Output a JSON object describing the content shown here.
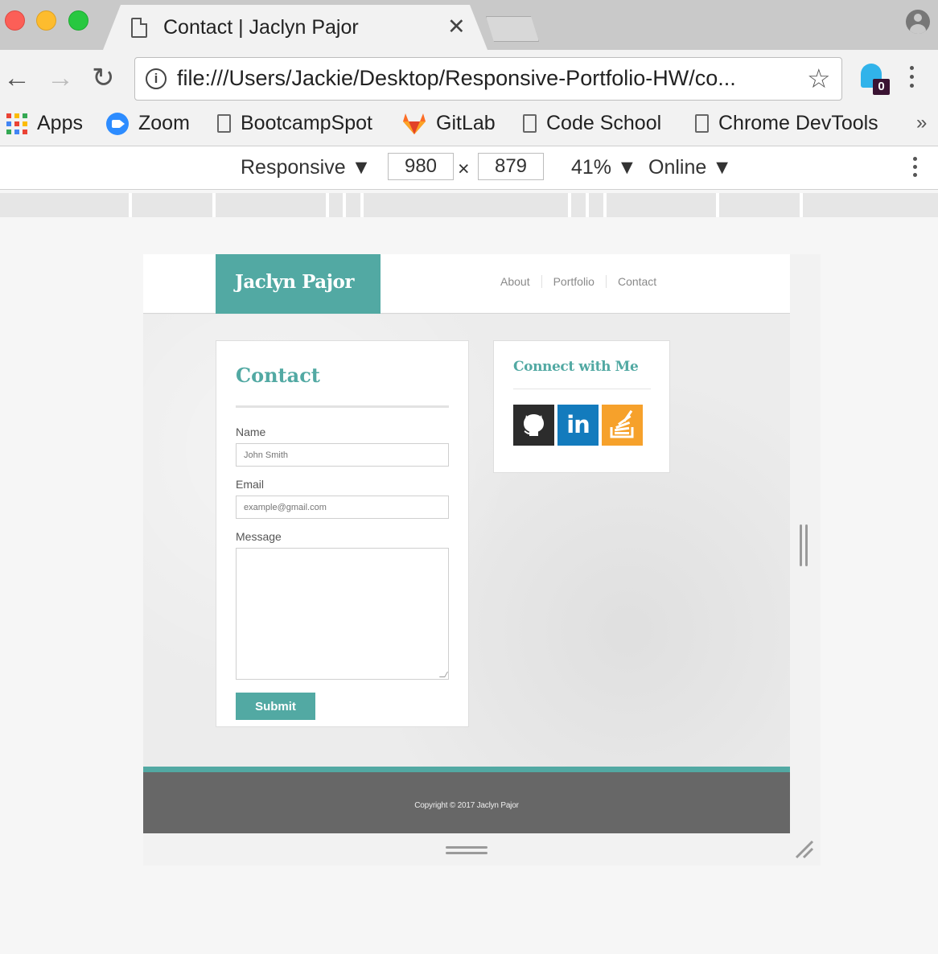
{
  "browser": {
    "tab_title": "Contact | Jaclyn Pajor",
    "tab_close": "✕",
    "url": "file:///Users/Jackie/Desktop/Responsive-Portfolio-HW/co...",
    "extension_badge": "0",
    "bookmarks": [
      {
        "label": "Apps",
        "icon": "apps-grid-icon"
      },
      {
        "label": "Zoom",
        "icon": "zoom-icon"
      },
      {
        "label": "BootcampSpot",
        "icon": "page-icon"
      },
      {
        "label": "GitLab",
        "icon": "gitlab-icon"
      },
      {
        "label": "Code School",
        "icon": "page-icon"
      },
      {
        "label": "Chrome DevTools",
        "icon": "page-icon"
      }
    ],
    "bookmarks_overflow": "»"
  },
  "devtools": {
    "device": "Responsive ▼",
    "width": "980",
    "times": "×",
    "height": "879",
    "zoom": "41% ▼",
    "network": "Online ▼"
  },
  "site": {
    "brand": "Jaclyn Pajor",
    "nav": [
      "About",
      "Portfolio",
      "Contact"
    ],
    "contact": {
      "title": "Contact",
      "name_label": "Name",
      "name_placeholder": "John Smith",
      "email_label": "Email",
      "email_placeholder": "example@gmail.com",
      "message_label": "Message",
      "submit": "Submit"
    },
    "connect": {
      "title": "Connect with Me",
      "linkedin_glyph": "in"
    },
    "footer": "Copyright © 2017 Jaclyn Pajor"
  },
  "colors": {
    "brand_teal": "#52a9a3",
    "footer_gray": "#676767",
    "linkedin_blue": "#137bbd",
    "stackoverflow_orange": "#f6a12b",
    "github_dark": "#2c2c2c"
  }
}
